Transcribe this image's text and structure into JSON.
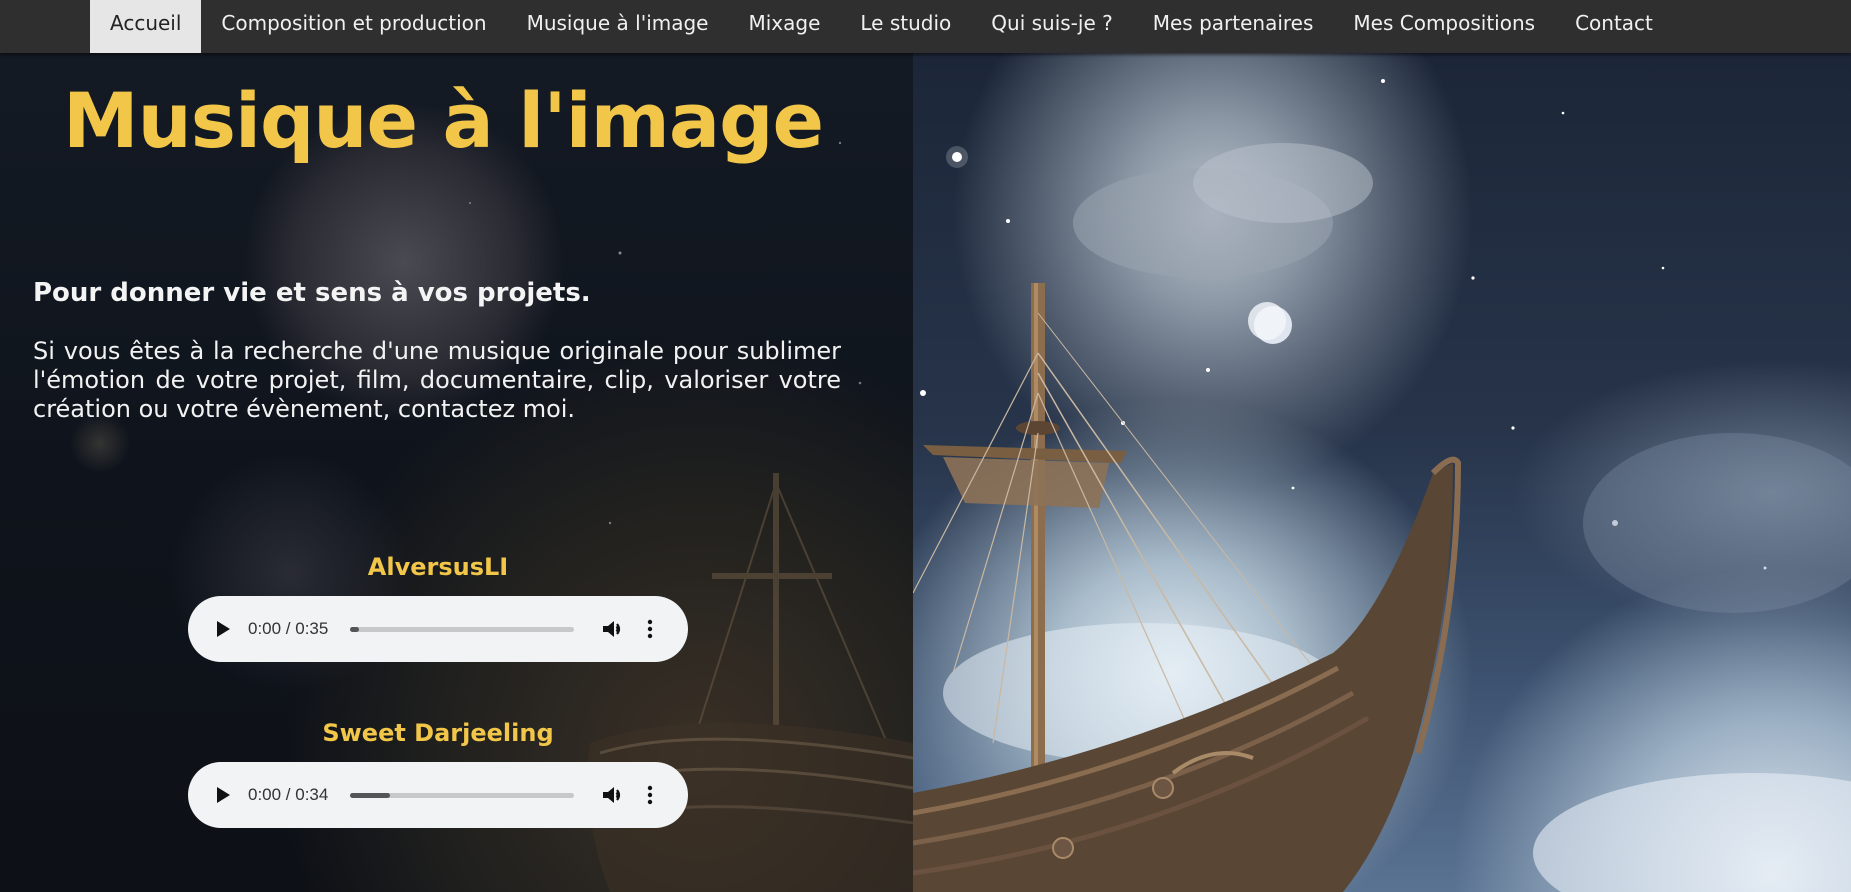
{
  "nav": {
    "items": [
      {
        "label": "Accueil",
        "active": true
      },
      {
        "label": "Composition et production",
        "active": false
      },
      {
        "label": "Musique à l'image",
        "active": false
      },
      {
        "label": "Mixage",
        "active": false
      },
      {
        "label": "Le studio",
        "active": false
      },
      {
        "label": "Qui suis-je ?",
        "active": false
      },
      {
        "label": "Mes partenaires",
        "active": false
      },
      {
        "label": "Mes Compositions",
        "active": false
      },
      {
        "label": "Contact",
        "active": false
      }
    ]
  },
  "hero": {
    "title": "Musique à l'image",
    "subtitle": "Pour donner vie et sens à vos projets.",
    "intro": "Si vous êtes à la recherche d'une musique originale pour sublimer l'émotion de votre projet, film, documentaire, clip, valoriser votre création ou votre évènement, contactez moi."
  },
  "tracks": [
    {
      "title": "AlversusLI",
      "time": "0:00 / 0:35",
      "progress": 0.04
    },
    {
      "title": "Sweet Darjeeling",
      "time": "0:00 / 0:34",
      "progress": 0.18
    }
  ],
  "colors": {
    "accent": "#f2c648",
    "nav_bg": "#2f2f2f",
    "nav_active_bg": "#e6e6e6",
    "player_bg": "#f1f3f4"
  },
  "icons": {
    "play": "play-icon",
    "volume": "volume-icon",
    "more": "more-vert-icon"
  }
}
